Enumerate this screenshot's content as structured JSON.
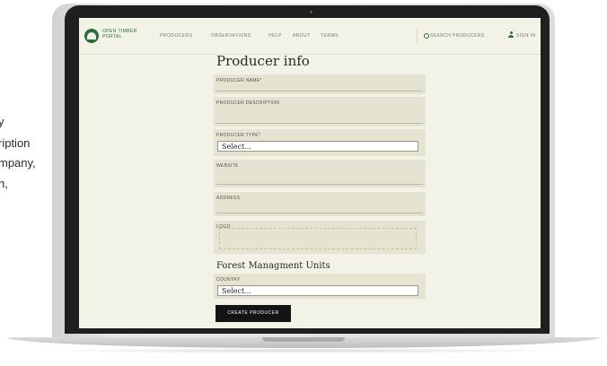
{
  "side_text": {
    "line1": "y",
    "line2": "ription",
    "line3": "mpany,",
    "line4": "h,"
  },
  "navbar": {
    "logo_text": "OPEN TIMBER PORTAL",
    "items": [
      {
        "label": "PRODUCERS"
      },
      {
        "label": "OBSERVATIONS"
      },
      {
        "label": "HELP"
      },
      {
        "label": "ABOUT"
      },
      {
        "label": "TERMS"
      }
    ],
    "search_placeholder": "SEARCH PRODUCERS",
    "signin_label": "SIGN IN",
    "icons": {
      "logo": "tree-logo-icon",
      "search": "search-icon",
      "user": "user-icon"
    },
    "brand_color": "#2e6b3a"
  },
  "form": {
    "title": "Producer info",
    "fields": [
      {
        "label": "PRODUCER NAME*",
        "value": ""
      },
      {
        "label": "PRODUCER DESCRIPTION",
        "value": ""
      },
      {
        "label": "PRODUCER TYPE*",
        "selected": "Select..."
      },
      {
        "label": "WEBSITE",
        "value": ""
      },
      {
        "label": "ADDRESS",
        "value": ""
      },
      {
        "label": "LOGO",
        "value": ""
      }
    ],
    "fmu_section_title": "Forest Managment Units",
    "country": {
      "label": "COUNTRY",
      "selected": "Select..."
    },
    "submit_label": "CREATE PRODUCER"
  }
}
